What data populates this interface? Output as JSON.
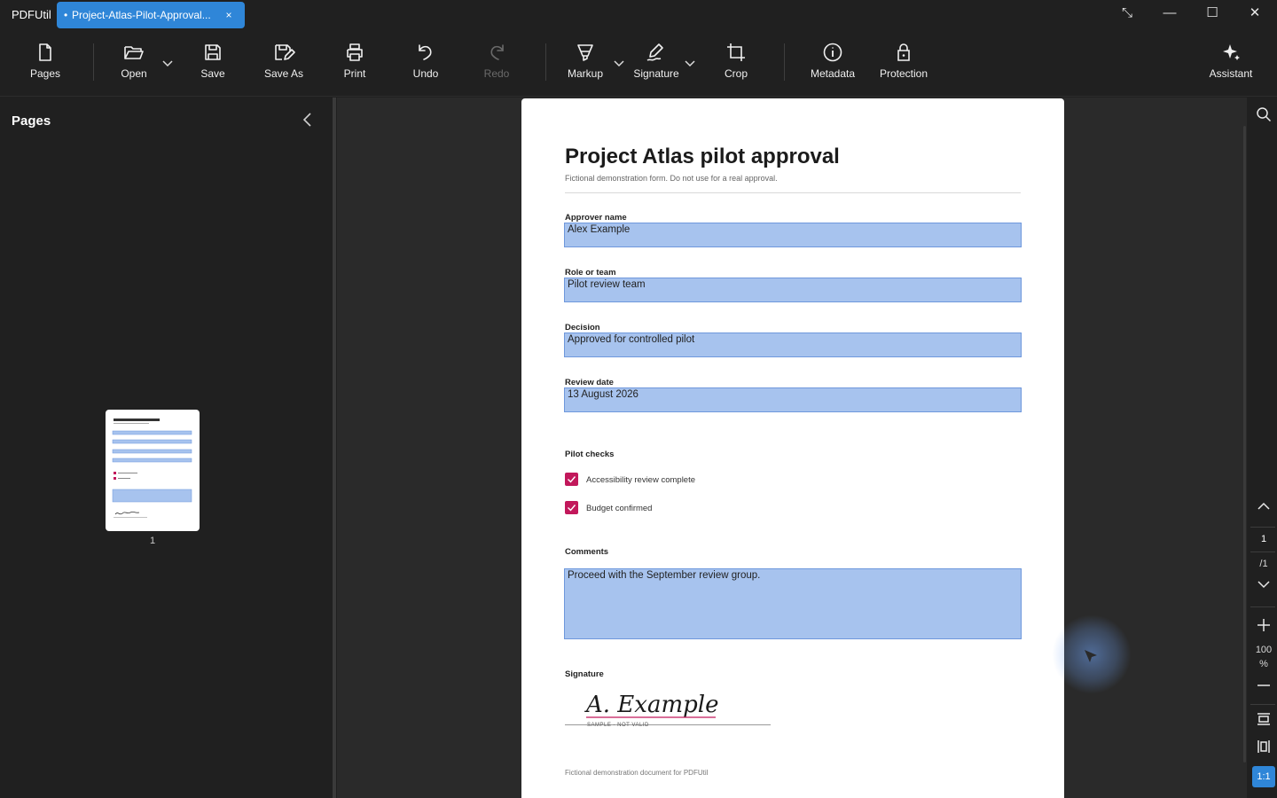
{
  "app": {
    "name": "PDFUtil"
  },
  "tab": {
    "title": "Project-Atlas-Pilot-Approval...",
    "modified_marker": "•",
    "close": "×"
  },
  "window": {
    "fullscreen": "⤡",
    "minimize": "—",
    "maximize": "☐",
    "close": "✕"
  },
  "toolbar": {
    "pages": "Pages",
    "open": "Open",
    "save": "Save",
    "save_as": "Save As",
    "print": "Print",
    "undo": "Undo",
    "redo": "Redo",
    "markup": "Markup",
    "signature": "Signature",
    "crop": "Crop",
    "metadata": "Metadata",
    "protection": "Protection",
    "assistant": "Assistant"
  },
  "sidebar": {
    "title": "Pages",
    "thumbnail_page": "1"
  },
  "document": {
    "title": "Project Atlas pilot approval",
    "subtitle": "Fictional demonstration form. Do not use for a real approval.",
    "fields": [
      {
        "label": "Approver name",
        "value": "Alex Example"
      },
      {
        "label": "Role or team",
        "value": "Pilot review team"
      },
      {
        "label": "Decision",
        "value": "Approved for controlled pilot"
      },
      {
        "label": "Review date",
        "value": "13 August 2026"
      }
    ],
    "checks_title": "Pilot checks",
    "checks": [
      {
        "label": "Accessibility review complete",
        "checked": true
      },
      {
        "label": "Budget confirmed",
        "checked": true
      }
    ],
    "comments_label": "Comments",
    "comments_value": "Proceed with the September review group.",
    "signature_label": "Signature",
    "signature_text": "A. Example",
    "signature_sample": "SAMPLE - NOT VALID",
    "footer": "Fictional demonstration document for PDFUtil"
  },
  "navigation": {
    "current_page": "1",
    "total_pages": "/1",
    "zoom_value": "100",
    "zoom_unit": "%",
    "actual_size": "1:1"
  },
  "colors": {
    "accent": "#2f86d8",
    "field_fill": "#a7c3ee",
    "checkbox": "#c2185b",
    "background": "#202020"
  }
}
